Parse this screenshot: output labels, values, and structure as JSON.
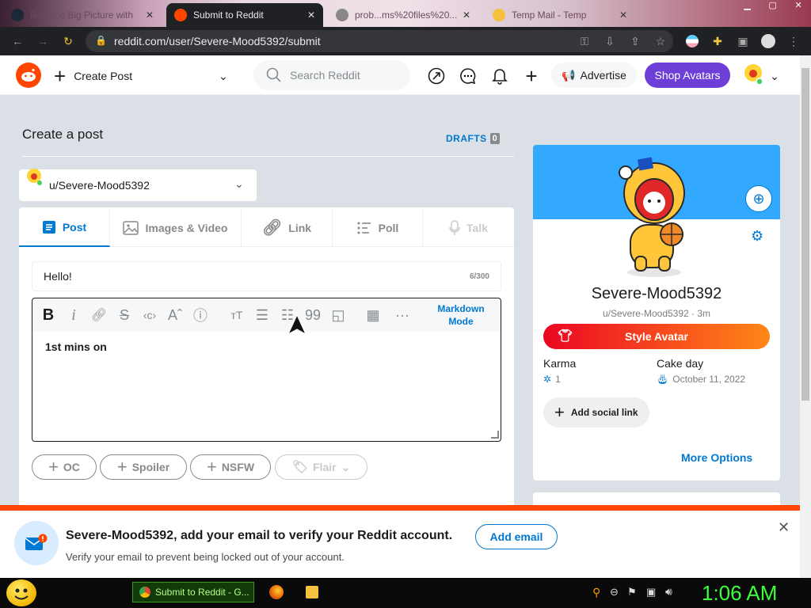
{
  "browser": {
    "tabs": [
      {
        "title": "Replace Big Picture with"
      },
      {
        "title": "Submit to Reddit",
        "active": true
      },
      {
        "title": "prob...ms%20files%20..."
      },
      {
        "title": "Temp Mail - Temp"
      }
    ],
    "url": "reddit.com/user/Severe-Mood5392/submit"
  },
  "header": {
    "create_post": "Create Post",
    "search_placeholder": "Search Reddit",
    "advertise": "Advertise",
    "shop_avatars": "Shop Avatars"
  },
  "main": {
    "page_title": "Create a post",
    "drafts_label": "DRAFTS",
    "drafts_count": "0",
    "community": "u/Severe-Mood5392",
    "tabs": [
      {
        "label": "Post"
      },
      {
        "label": "Images & Video"
      },
      {
        "label": "Link"
      },
      {
        "label": "Poll"
      },
      {
        "label": "Talk"
      }
    ],
    "title_value": "Hello!",
    "title_count": "6/300",
    "markdown_mode": "Markdown Mode",
    "body_text": "1st mins on",
    "flags": {
      "oc": "OC",
      "spoiler": "Spoiler",
      "nsfw": "NSFW",
      "flair": "Flair"
    }
  },
  "profile": {
    "username": "Severe-Mood5392",
    "handle": "u/Severe-Mood5392 · 3m",
    "style_avatar": "Style Avatar",
    "karma_label": "Karma",
    "karma_value": "1",
    "cakeday_label": "Cake day",
    "cakeday_value": "October 11, 2022",
    "add_social": "Add social link",
    "more_options": "More Options"
  },
  "notice": {
    "title": "Severe-Mood5392, add your email to verify your Reddit account.",
    "subtitle": "Verify your email to prevent being locked out of your account.",
    "button": "Add email"
  },
  "taskbar": {
    "task_label": "Submit to Reddit - G...",
    "clock": "1:06 AM"
  },
  "colors": {
    "accent": "#0079d3",
    "brand": "#ff4500",
    "shop": "#6d3fd6"
  }
}
